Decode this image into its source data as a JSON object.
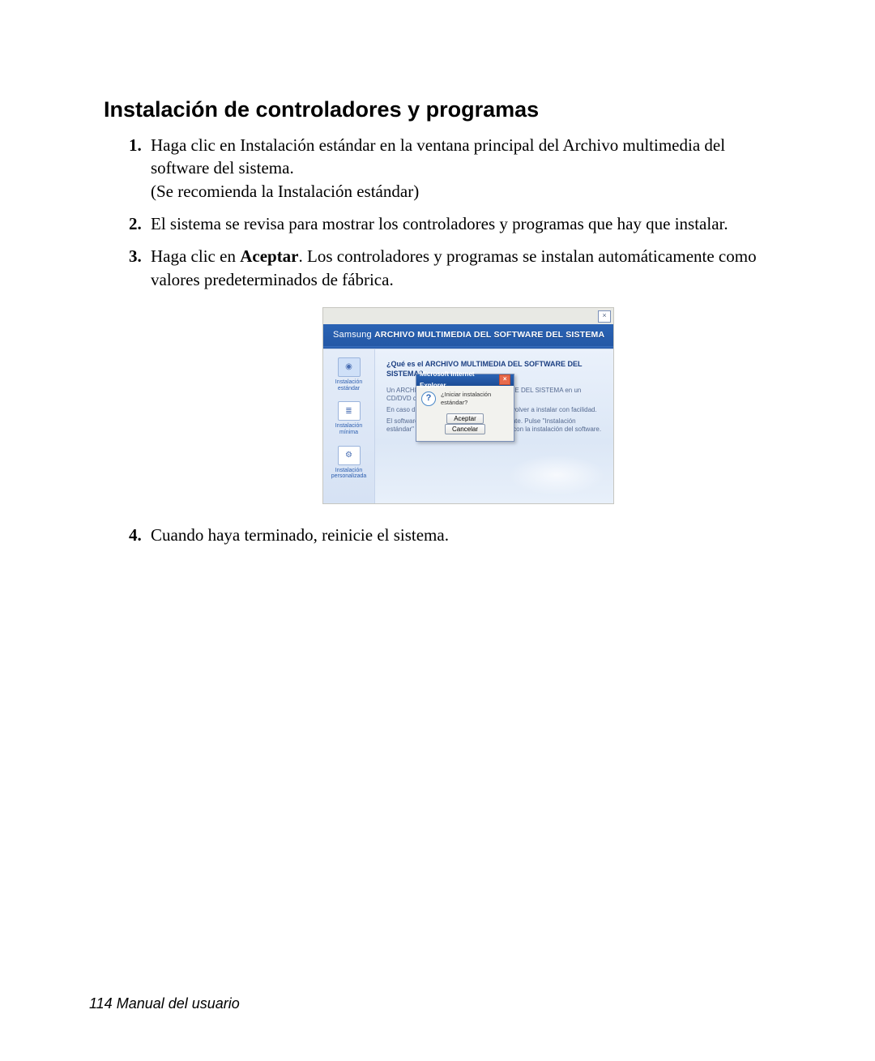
{
  "heading": "Instalación de controladores y programas",
  "steps": {
    "s1a": "Haga clic en Instalación estándar en la ventana principal del Archivo multimedia del software del sistema.",
    "s1b": "(Se recomienda la Instalación estándar)",
    "s2": "El sistema se revisa para mostrar los controladores y programas que hay que instalar.",
    "s3a": "Haga clic en ",
    "s3bold": "Aceptar",
    "s3b": ". Los controladores y programas se instalan automáticamente como valores predeterminados de fábrica.",
    "s4": "Cuando haya terminado, reinicie el sistema."
  },
  "screenshot": {
    "outer_close": "×",
    "brand": "Samsung",
    "app_title": "ARCHIVO MULTIMEDIA DEL SOFTWARE DEL SISTEMA",
    "sidebar": {
      "i1": "Instalación estándar",
      "i2": "Instalación mínima",
      "i3": "Instalación personalizada"
    },
    "panel": {
      "heading": "¿Qué es el ARCHIVO MULTIMEDIA DEL SOFTWARE DEL SISTEMA?",
      "p1": "Un ARCHIVO MULTIMEDIA DEL SOFTWARE DEL SISTEMA en un CD/DVD que suministra Samsung.",
      "p2": "En caso de borrado, el software se pueden volver a instalar con facilidad.",
      "p3": "El software necesario se instala correctamente. Pulse \"Instalación estándar\" o \"Instalación mínima\" y continúe con la instalación del software."
    },
    "dialog": {
      "title": "Microsoft Internet Explorer",
      "close": "×",
      "icon": "?",
      "message": "¿Iniciar instalación estándar?",
      "ok": "Aceptar",
      "cancel": "Cancelar"
    }
  },
  "footer": "114  Manual del usuario"
}
